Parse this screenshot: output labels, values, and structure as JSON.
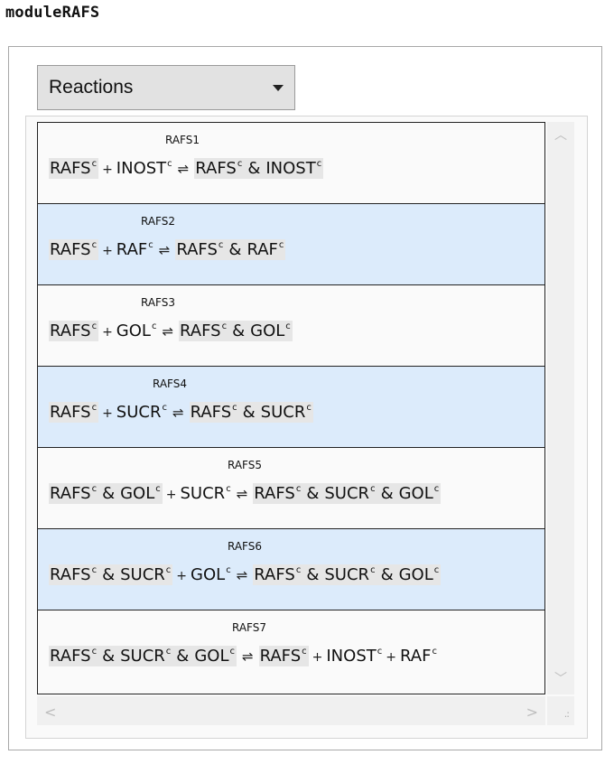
{
  "title": "moduleRAFS",
  "dropdown": {
    "selected": "Reactions"
  },
  "compartment": "c",
  "reactions": [
    {
      "id": "RAFS1",
      "lhs": [
        [
          "RAFS"
        ],
        [
          "INOST"
        ]
      ],
      "rhs_complex": [
        "RAFS",
        "INOST"
      ]
    },
    {
      "id": "RAFS2",
      "lhs": [
        [
          "RAFS"
        ],
        [
          "RAF"
        ]
      ],
      "rhs_complex": [
        "RAFS",
        "RAF"
      ]
    },
    {
      "id": "RAFS3",
      "lhs": [
        [
          "RAFS"
        ],
        [
          "GOL"
        ]
      ],
      "rhs_complex": [
        "RAFS",
        "GOL"
      ]
    },
    {
      "id": "RAFS4",
      "lhs": [
        [
          "RAFS"
        ],
        [
          "SUCR"
        ]
      ],
      "rhs_complex": [
        "RAFS",
        "SUCR"
      ]
    },
    {
      "id": "RAFS5",
      "lhs": [
        [
          "RAFS",
          "GOL"
        ],
        [
          "SUCR"
        ]
      ],
      "rhs_complex": [
        "RAFS",
        "SUCR",
        "GOL"
      ]
    },
    {
      "id": "RAFS6",
      "lhs": [
        [
          "RAFS",
          "SUCR"
        ],
        [
          "GOL"
        ]
      ],
      "rhs_complex": [
        "RAFS",
        "SUCR",
        "GOL"
      ]
    },
    {
      "id": "RAFS7",
      "lhs": [
        [
          "RAFS",
          "SUCR",
          "GOL"
        ]
      ],
      "rhs": [
        [
          "RAFS"
        ],
        [
          "INOST"
        ],
        [
          "RAF"
        ]
      ]
    }
  ],
  "symbols": {
    "plus": "+",
    "reversible": "⇌",
    "complex_joiner": "&"
  },
  "icons": {
    "scroll_up": "chevron-up-icon",
    "scroll_down": "chevron-down-icon",
    "scroll_left": "chevron-left-icon",
    "scroll_right": "chevron-right-icon",
    "resize": "resize-grip-icon"
  },
  "colors": {
    "row_alt": "#dcebfb",
    "row_normal": "#fafafa",
    "species_bg": "#e6e6e6"
  }
}
